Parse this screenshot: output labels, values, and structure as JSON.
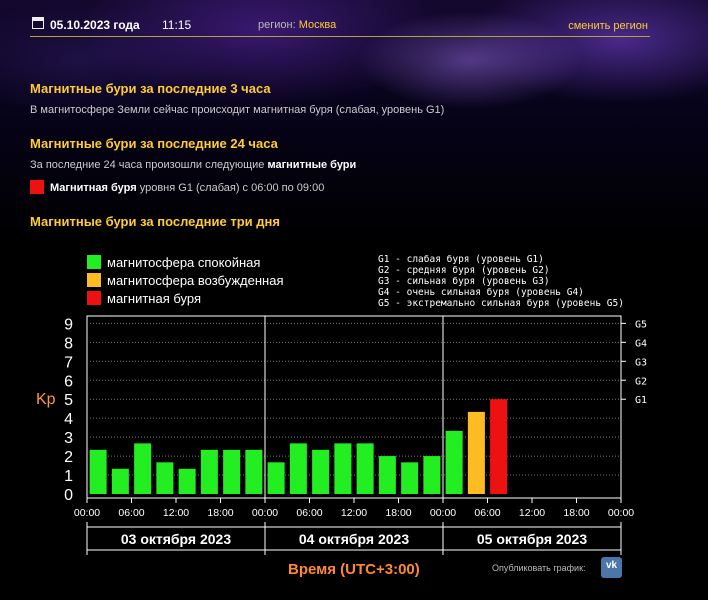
{
  "header": {
    "date": "05.10.2023 года",
    "time": "11:15",
    "region_label": "регион:",
    "region_value": "Москва",
    "change_region": "сменить регион"
  },
  "sections": {
    "last3h_title": "Магнитные бури за последние 3 часа",
    "last3h_text": "В магнитосфере Земли сейчас происходит магнитная буря (слабая, уровень G1)",
    "last24h_title": "Магнитные бури за последние 24 часа",
    "last24h_text_prefix": "За последние 24 часа произошли следующие",
    "last24h_text_bold": "магнитные бури",
    "storm_bold": "Магнитная буря",
    "storm_rest": "уровня G1 (слабая) с 06:00 по 09:00",
    "days3_title": "Магнитные бури за последние три дня"
  },
  "legend": [
    {
      "label": "магнитосфера спокойная",
      "color": "#22ee22"
    },
    {
      "label": "магнитосфера возбужденная",
      "color": "#ffbb22"
    },
    {
      "label": "магнитная буря",
      "color": "#ee1111"
    }
  ],
  "g_levels": [
    "G1 - слабая буря (уровень G1)",
    "G2 - средняя буря (уровень G2)",
    "G3 - сильная буря (уровень G3)",
    "G4 - очень сильная буря (уровень G4)",
    "G5 - экстремально сильная буря (уровень G5)"
  ],
  "chart_data": {
    "type": "bar",
    "ylabel": "Kp",
    "xlabel": "Время (UTC+3:00)",
    "ylim": [
      0,
      9
    ],
    "y_ticks": [
      "0",
      "1",
      "2",
      "3",
      "4",
      "5",
      "6",
      "7",
      "8",
      "9"
    ],
    "g_ticks": [
      {
        "label": "G1",
        "value": 5
      },
      {
        "label": "G2",
        "value": 6
      },
      {
        "label": "G3",
        "value": 7
      },
      {
        "label": "G4",
        "value": 8
      },
      {
        "label": "G5",
        "value": 9
      }
    ],
    "grid": true,
    "days": [
      "03 октября 2023",
      "04 октября 2023",
      "05 октября 2023"
    ],
    "x_tick_labels": [
      "00:00",
      "06:00",
      "12:00",
      "18:00",
      "00:00",
      "06:00",
      "12:00",
      "18:00",
      "00:00",
      "06:00",
      "12:00",
      "18:00",
      "00:00"
    ],
    "categories": [
      "03.10 00:00",
      "03.10 03:00",
      "03.10 06:00",
      "03.10 09:00",
      "03.10 12:00",
      "03.10 15:00",
      "03.10 18:00",
      "03.10 21:00",
      "04.10 00:00",
      "04.10 03:00",
      "04.10 06:00",
      "04.10 09:00",
      "04.10 12:00",
      "04.10 15:00",
      "04.10 18:00",
      "04.10 21:00",
      "05.10 00:00",
      "05.10 03:00",
      "05.10 06:00"
    ],
    "values": [
      2.33,
      1.33,
      2.67,
      1.67,
      1.33,
      2.33,
      2.33,
      2.33,
      1.67,
      2.67,
      2.33,
      2.67,
      2.67,
      2.0,
      1.67,
      2.0,
      3.33,
      4.33,
      5.0
    ],
    "colors": {
      "quiet": "#22ee22",
      "unsettled": "#ffbb22",
      "storm": "#ee1111"
    },
    "status": [
      "quiet",
      "quiet",
      "quiet",
      "quiet",
      "quiet",
      "quiet",
      "quiet",
      "quiet",
      "quiet",
      "quiet",
      "quiet",
      "quiet",
      "quiet",
      "quiet",
      "quiet",
      "quiet",
      "quiet",
      "unsettled",
      "storm"
    ]
  },
  "publish": {
    "label": "Опубликовать график:",
    "vk_icon": "vk-icon",
    "vk_text": "vk"
  }
}
